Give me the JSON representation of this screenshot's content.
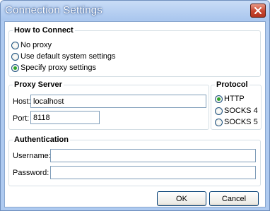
{
  "window": {
    "title": "Connection Settings"
  },
  "how_to_connect": {
    "legend": "How to Connect",
    "options": [
      {
        "label": "No proxy",
        "selected": false
      },
      {
        "label": "Use default system settings",
        "selected": false
      },
      {
        "label": "Specify proxy settings",
        "selected": true
      }
    ]
  },
  "proxy_server": {
    "legend": "Proxy Server",
    "host_label": "Host:",
    "host_value": "localhost",
    "port_label": "Port:",
    "port_value": "8118"
  },
  "protocol": {
    "legend": "Protocol",
    "options": [
      {
        "label": "HTTP",
        "selected": true
      },
      {
        "label": "SOCKS 4",
        "selected": false
      },
      {
        "label": "SOCKS 5",
        "selected": false
      }
    ]
  },
  "authentication": {
    "legend": "Authentication",
    "username_label": "Username:",
    "username_value": "",
    "password_label": "Password:",
    "password_value": ""
  },
  "buttons": {
    "ok": "OK",
    "cancel": "Cancel"
  },
  "colors": {
    "title_bar": "#aecaf0",
    "close_button": "#c8452f",
    "radio_selected": "#2ea42e",
    "group_border": "#d5dfe5"
  }
}
